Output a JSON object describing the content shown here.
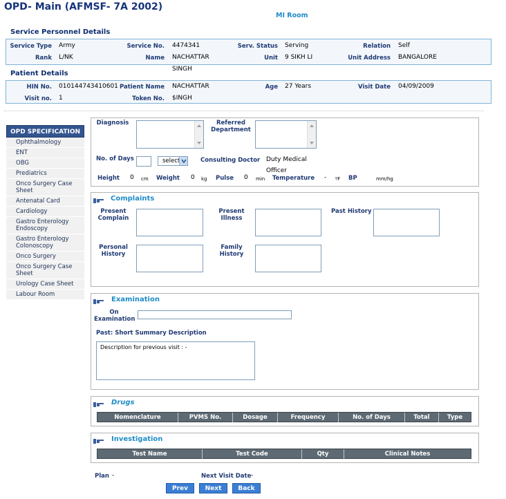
{
  "page_title": "OPD- Main (AFMSF- 7A 2002)",
  "room": "MI Room",
  "service_personnel": {
    "tab_label": "Service Personnel Details",
    "service_type_label": "Service Type",
    "service_type": "Army",
    "service_no_label": "Service No.",
    "service_no": "4474341",
    "serv_status_label": "Serv. Status",
    "serv_status": "Serving",
    "relation_label": "Relation",
    "relation": "Self",
    "rank_label": "Rank",
    "rank": "L/NK",
    "name_label": "Name",
    "name_line1": "NACHATTAR",
    "name_line2": "SINGH",
    "unit_label": "Unit",
    "unit": "9 SIKH LI",
    "unit_address_label": "Unit Address",
    "unit_address": "BANGALORE"
  },
  "patient": {
    "tab_label": "Patient Details",
    "hin_label": "HIN No.",
    "hin": "010144743410601",
    "patient_name_label": "Patient Name",
    "patient_name": "NACHATTAR",
    "age_label": "Age",
    "age": "27 Years",
    "visit_date_label": "Visit Date",
    "visit_date": "04/09/2009",
    "visit_no_label": "Visit no.",
    "visit_no": "1",
    "token_label": "Token No.",
    "token": "$INGH"
  },
  "sidebar": {
    "heading": "OPD SPECIFICATION",
    "items": [
      {
        "line1": "Ophthalmology",
        "line2": ""
      },
      {
        "line1": "ENT",
        "line2": ""
      },
      {
        "line1": "OBG",
        "line2": ""
      },
      {
        "line1": "Prediatrics",
        "line2": ""
      },
      {
        "line1": "Onco Surgery Case",
        "line2": "Sheet"
      },
      {
        "line1": "Antenatal Card",
        "line2": ""
      },
      {
        "line1": "Cardiology",
        "line2": ""
      },
      {
        "line1": "Gastro Enterology",
        "line2": "Endoscopy"
      },
      {
        "line1": "Gastro Enterology",
        "line2": "Colonoscopy"
      },
      {
        "line1": "Onco Surgery",
        "line2": ""
      },
      {
        "line1": "Onco Surgery Case",
        "line2": "Sheet"
      },
      {
        "line1": "Urology Case Sheet",
        "line2": ""
      },
      {
        "line1": "Labour Room",
        "line2": ""
      }
    ]
  },
  "diagnosis": {
    "diagnosis_label": "Diagnosis",
    "referred_label_1": "Referred",
    "referred_label_2": "Department",
    "days_label": "No. of Days",
    "days_value": "",
    "select_value": "select",
    "consulting_label": "Consulting Doctor",
    "consulting_value_1": "Duty Medical",
    "consulting_value_2": "Officer",
    "height_label": "Height",
    "height_value": "0",
    "height_unit": "cm",
    "weight_label": "Weight",
    "weight_value": "0",
    "weight_unit": "kg",
    "pulse_label": "Pulse",
    "pulse_value": "0",
    "pulse_unit": "min",
    "temp_label": "Temperature",
    "temp_value": "-",
    "temp_unit": "ºF",
    "bp_label": "BP",
    "bp_unit": "mm/hg"
  },
  "complaints": {
    "title": "Complaints",
    "present_complain_1": "Present",
    "present_complain_2": "Complain",
    "present_illness_1": "Present",
    "present_illness_2": "Illness",
    "past_history": "Past History",
    "personal_history_1": "Personal",
    "personal_history_2": "History",
    "family_history_1": "Family",
    "family_history_2": "History"
  },
  "examination": {
    "title": "Examination",
    "on_exam_1": "On",
    "on_exam_2": "Examination",
    "on_exam_value": "",
    "past_summary_label": "Past: Short Summary Description",
    "past_summary_text": "Description for previous visit : -"
  },
  "drugs": {
    "title": "Drugs",
    "columns": [
      "Nomenclature",
      "PVMS No.",
      "Dosage",
      "Frequency",
      "No. of Days",
      "Total",
      "Type"
    ]
  },
  "investigation": {
    "title": "Investigation",
    "columns": [
      "Test Name",
      "Test Code",
      "Qty",
      "Clinical Notes"
    ]
  },
  "footer": {
    "plan_label": "Plan",
    "plan_value": "-",
    "next_visit_label": "Next Visit Date",
    "next_visit_value": "-",
    "prev_button": "Prev",
    "next_button": "Next",
    "back_button": "Back"
  },
  "colors": {
    "label": "#1f3a73",
    "accent": "#1f8bc8",
    "button": "#3b7fd4",
    "table_header": "#5d6a73",
    "sidebar_head": "#33558f"
  }
}
